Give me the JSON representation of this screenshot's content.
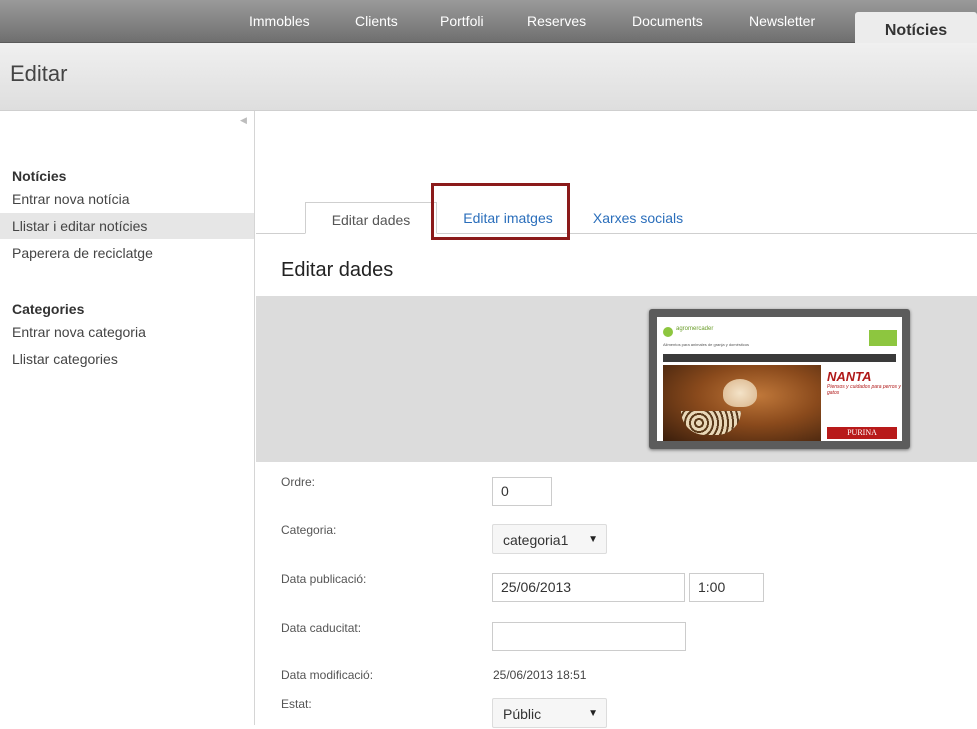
{
  "nav": {
    "items": [
      "Immobles",
      "Clients",
      "Portfoli",
      "Reserves",
      "Documents",
      "Newsletter"
    ],
    "active": "Notícies"
  },
  "header": {
    "title": "Editar"
  },
  "sidebar": {
    "sections": [
      {
        "title": "Notícies",
        "items": [
          "Entrar nova notícia",
          "Llistar i editar notícies",
          "Paperera de reciclatge"
        ],
        "selected_index": 1
      },
      {
        "title": "Categories",
        "items": [
          "Entrar nova categoria",
          "Llistar categories"
        ]
      }
    ]
  },
  "tabs": [
    "Editar dades",
    "Editar imatges",
    "Xarxes socials"
  ],
  "section_title": "Editar dades",
  "preview": {
    "logo_text": "agromercader",
    "tagline": "Alimentos para animales de granja y domésticos",
    "ad1_brand": "NANTA",
    "ad1_sub": "Piensos y cuidados para perros y gatos",
    "ad2_brand": "PURINA"
  },
  "form": {
    "ordre": {
      "label": "Ordre:",
      "value": "0"
    },
    "categoria": {
      "label": "Categoria:",
      "value": "categoria1"
    },
    "data_publicacio": {
      "label": "Data publicació:",
      "date": "25/06/2013",
      "time": "1:00"
    },
    "data_caducitat": {
      "label": "Data caducitat:",
      "value": ""
    },
    "data_modificacio": {
      "label": "Data modificació:",
      "value": "25/06/2013 18:51"
    },
    "estat": {
      "label": "Estat:",
      "value": "Públic"
    }
  },
  "colors": {
    "link": "#2a6ebb",
    "highlight_border": "#8b1a1a",
    "nav_bg": "#7f7f7f"
  }
}
